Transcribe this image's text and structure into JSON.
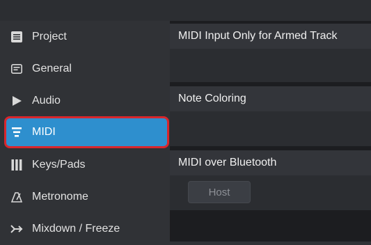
{
  "sidebar": {
    "items": [
      {
        "label": "Project",
        "icon": "list-icon"
      },
      {
        "label": "General",
        "icon": "panel-icon"
      },
      {
        "label": "Audio",
        "icon": "play-icon"
      },
      {
        "label": "MIDI",
        "icon": "midi-icon",
        "selected": true
      },
      {
        "label": "Keys/Pads",
        "icon": "keys-icon"
      },
      {
        "label": "Metronome",
        "icon": "metronome-icon"
      },
      {
        "label": "Mixdown / Freeze",
        "icon": "mixdown-icon"
      }
    ]
  },
  "content": {
    "sections": [
      {
        "title": "MIDI Input Only for Armed Track"
      },
      {
        "title": "Note Coloring"
      },
      {
        "title": "MIDI over Bluetooth",
        "button_label": "Host"
      }
    ]
  },
  "colors": {
    "selected_bg": "#2e8fce",
    "highlight_border": "#d9262c"
  }
}
